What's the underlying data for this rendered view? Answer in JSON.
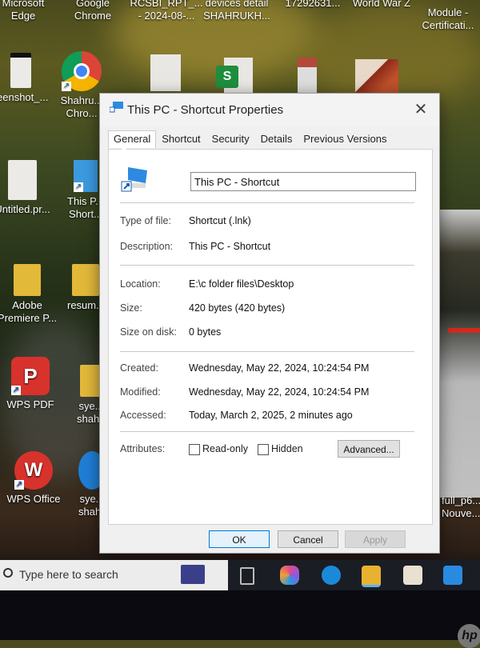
{
  "desktop": {
    "top_row_labels": [
      {
        "line1": "Microsoft",
        "line2": "Edge"
      },
      {
        "line1": "Google",
        "line2": "Chrome"
      },
      {
        "line1": "RCSBI_RPT_...",
        "line2": "- 2024-08-..."
      },
      {
        "line1": "devices detail",
        "line2": "SHAHRUKH..."
      },
      {
        "line1": "17292631...",
        "line2": ""
      },
      {
        "line1": "World War Z",
        "line2": ""
      },
      {
        "line1": "Module -",
        "line2": "Certificati..."
      }
    ],
    "icons": [
      {
        "label": "reenshot_...",
        "icon": "document-icon"
      },
      {
        "label": "Shahru... Chro...",
        "icon": "chrome-icon"
      },
      {
        "label": "Untitled.pr...",
        "icon": "document-icon"
      },
      {
        "label": "This P... Short...",
        "icon": "this-pc-icon"
      },
      {
        "label": "Adobe Premiere P...",
        "icon": "folder-icon"
      },
      {
        "label": "resum...",
        "icon": "folder-icon"
      },
      {
        "label": "WPS PDF",
        "icon": "wps-pdf-icon"
      },
      {
        "label": "sye... shahru...",
        "icon": "folder-icon"
      },
      {
        "label": "WPS Office",
        "icon": "wps-office-icon"
      },
      {
        "label": "sye... shahr...",
        "icon": "edge-icon"
      },
      {
        "label": "full_p6... Nouve...",
        "icon": "document-icon"
      }
    ]
  },
  "dialog": {
    "title": "This PC - Shortcut Properties",
    "close_glyph": "✕",
    "tabs": [
      {
        "label": "General",
        "active": true
      },
      {
        "label": "Shortcut",
        "active": false
      },
      {
        "label": "Security",
        "active": false
      },
      {
        "label": "Details",
        "active": false
      },
      {
        "label": "Previous Versions",
        "active": false
      }
    ],
    "name_value": "This PC - Shortcut",
    "properties": {
      "type_label": "Type of file:",
      "type_value": "Shortcut (.lnk)",
      "description_label": "Description:",
      "description_value": "This PC - Shortcut",
      "location_label": "Location:",
      "location_value": "E:\\c folder files\\Desktop",
      "size_label": "Size:",
      "size_value": "420 bytes (420 bytes)",
      "size_on_disk_label": "Size on disk:",
      "size_on_disk_value": "0 bytes",
      "created_label": "Created:",
      "created_value": "Wednesday, May 22, 2024, 10:24:54 PM",
      "modified_label": "Modified:",
      "modified_value": "Wednesday, May 22, 2024, 10:24:54 PM",
      "accessed_label": "Accessed:",
      "accessed_value": "Today, March 2, 2025, 2 minutes ago",
      "attributes_label": "Attributes:",
      "readonly_label": "Read-only",
      "readonly_checked": false,
      "hidden_label": "Hidden",
      "hidden_checked": false,
      "advanced_label": "Advanced..."
    },
    "buttons": {
      "ok": "OK",
      "cancel": "Cancel",
      "apply": "Apply"
    }
  },
  "taskbar": {
    "search_placeholder": "Type here to search",
    "apps": [
      "task-view",
      "copilot",
      "edge",
      "file-explorer",
      "microsoft-store",
      "mail"
    ]
  },
  "brand": {
    "monitor_logo": "hp"
  }
}
